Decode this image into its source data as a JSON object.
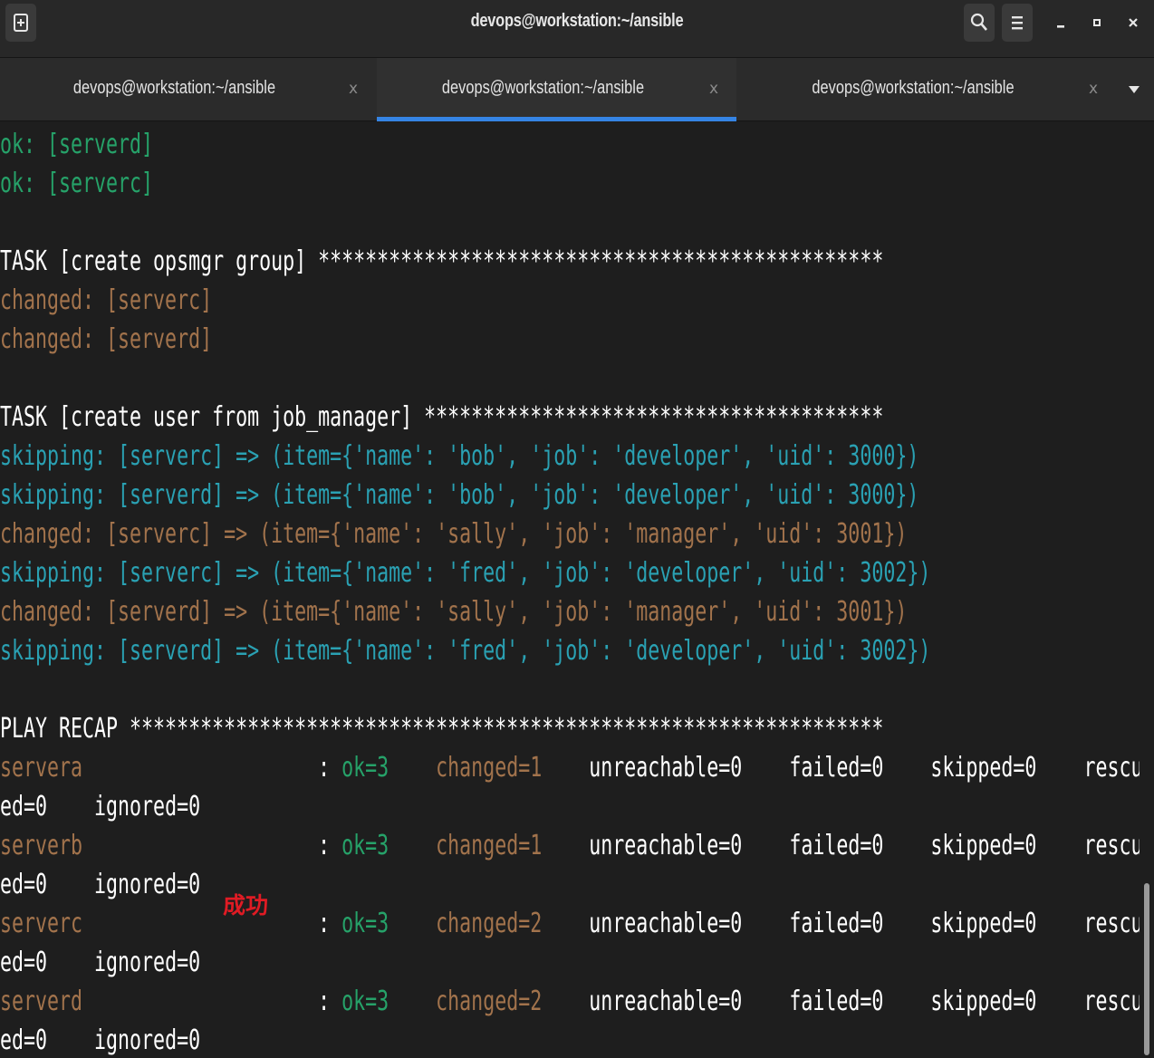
{
  "window": {
    "title": "devops@workstation:~/ansible"
  },
  "tabs": [
    {
      "label": "devops@workstation:~/ansible",
      "close": "x",
      "active": false
    },
    {
      "label": "devops@workstation:~/ansible",
      "close": "x",
      "active": true
    },
    {
      "label": "devops@workstation:~/ansible",
      "close": "x",
      "active": false
    }
  ],
  "icons": {
    "new_tab": "new-tab-icon",
    "search": "search-icon",
    "menu": "hamburger-menu-icon",
    "minimize": "minimize-icon",
    "maximize": "maximize-icon",
    "close": "close-icon",
    "tab_list": "chevron-down-icon"
  },
  "colors": {
    "ok": "#26a269",
    "changed": "#a2734c",
    "skipping": "#2aa1b3",
    "accent": "#3584e4",
    "annotation": "#e01b24"
  },
  "terminal": {
    "lines": [
      {
        "color": "green",
        "text": "ok: [serverd]"
      },
      {
        "color": "green",
        "text": "ok: [serverc]"
      },
      {
        "color": "white",
        "text": ""
      },
      {
        "color": "white",
        "text": "TASK [create opsmgr group] ************************************************"
      },
      {
        "color": "orange",
        "text": "changed: [serverc]"
      },
      {
        "color": "orange",
        "text": "changed: [serverd]"
      },
      {
        "color": "white",
        "text": ""
      },
      {
        "color": "white",
        "text": "TASK [create user from job_manager] ***************************************"
      },
      {
        "color": "cyan",
        "text": "skipping: [serverc] => (item={'name': 'bob', 'job': 'developer', 'uid': 3000})"
      },
      {
        "color": "cyan",
        "text": "skipping: [serverd] => (item={'name': 'bob', 'job': 'developer', 'uid': 3000})"
      },
      {
        "color": "orange",
        "text": "changed: [serverc] => (item={'name': 'sally', 'job': 'manager', 'uid': 3001})"
      },
      {
        "color": "cyan",
        "text": "skipping: [serverc] => (item={'name': 'fred', 'job': 'developer', 'uid': 3002})"
      },
      {
        "color": "orange",
        "text": "changed: [serverd] => (item={'name': 'sally', 'job': 'manager', 'uid': 3001})"
      },
      {
        "color": "cyan",
        "text": "skipping: [serverd] => (item={'name': 'fred', 'job': 'developer', 'uid': 3002})"
      },
      {
        "color": "white",
        "text": ""
      },
      {
        "color": "white",
        "text": "PLAY RECAP ****************************************************************"
      }
    ],
    "recap": [
      {
        "host": "servera",
        "ok": "ok=3",
        "changed": "changed=1",
        "unreachable": "unreachable=0",
        "failed": "failed=0",
        "skipped": "skipped=0",
        "rescued_head": "rescu",
        "rescued_tail": "ed=0",
        "ignored": "ignored=0"
      },
      {
        "host": "serverb",
        "ok": "ok=3",
        "changed": "changed=1",
        "unreachable": "unreachable=0",
        "failed": "failed=0",
        "skipped": "skipped=0",
        "rescued_head": "rescu",
        "rescued_tail": "ed=0",
        "ignored": "ignored=0"
      },
      {
        "host": "serverc",
        "ok": "ok=3",
        "changed": "changed=2",
        "unreachable": "unreachable=0",
        "failed": "failed=0",
        "skipped": "skipped=0",
        "rescued_head": "rescu",
        "rescued_tail": "ed=0",
        "ignored": "ignored=0"
      },
      {
        "host": "serverd",
        "ok": "ok=3",
        "changed": "changed=2",
        "unreachable": "unreachable=0",
        "failed": "failed=0",
        "skipped": "skipped=0",
        "rescued_head": "rescu",
        "rescued_tail": "ed=0",
        "ignored": "ignored=0"
      }
    ]
  },
  "annotation": {
    "text": "成功"
  }
}
